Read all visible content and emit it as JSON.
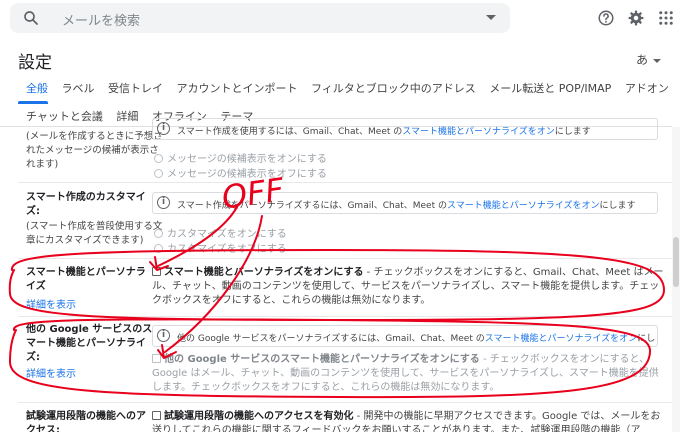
{
  "search": {
    "placeholder": "メールを検索"
  },
  "header": {
    "title": "設定",
    "lang": "あ"
  },
  "tabs_row1": [
    "全般",
    "ラベル",
    "受信トレイ",
    "アカウントとインポート",
    "フィルタとブロック中のアドレス",
    "メール転送と POP/IMAP",
    "アドオン"
  ],
  "tabs_row2": [
    "チャットと会議",
    "詳細",
    "オフライン",
    "テーマ"
  ],
  "row0": {
    "sub": [
      "(メールを作成するときに予想さ",
      "れたメッセージの候補が表示さ",
      "れます)"
    ],
    "info_pre": "スマート作成を使用するには、Gmail、Chat、Meet の",
    "info_link": "スマート機能とパーソナライズをオン",
    "info_post": "にします",
    "radio_on": "メッセージの候補表示をオンにする",
    "radio_off": "メッセージの候補表示をオフにする"
  },
  "row1": {
    "label": [
      "スマート作成のカスタマイ",
      "ズ:"
    ],
    "sub": [
      "(スマート作成を普段使用する文",
      "章にカスタマイズできます)"
    ],
    "info_pre": "スマート作成をパーソナライズするには、Gmail、Chat、Meet の",
    "info_link": "スマート機能とパーソナライズをオン",
    "info_post": "にします",
    "radio_on": "カスタマイズをオンにする",
    "radio_off": "カスタマイズをオフにする"
  },
  "row2": {
    "label": [
      "スマート機能とパーソナラ",
      "イズ"
    ],
    "more": "詳細を表示",
    "bold": "スマート機能とパーソナライズをオンにする",
    "desc": " - チェックボックスをオンにすると、Gmail、Chat、Meet はメール、チャット、動画のコンテンツを使用して、サービスをパーソナライズし、スマート機能を提供します。チェックボックスをオフにすると、これらの機能は無効になります。"
  },
  "row3": {
    "label": [
      "他の Google サービスのス",
      "マート機能とパーソナライ",
      "ズ:"
    ],
    "more": "詳細を表示",
    "info_pre": "他の Google サービスをパーソナライズするには、Gmail、Chat、Meet の",
    "info_link": "スマート機能とパーソナライズをオン",
    "info_post": "にします",
    "bold": "他の Google サービスのスマート機能とパーソナライズをオンにする",
    "desc": " - チェックボックスをオンにすると、Google はメール、チャット、動画のコンテンツを使用して、サービスをパーソナライズし、スマート機能を提供します。チェックボックスをオフにすると、これらの機能は無効になります。"
  },
  "row4": {
    "label": [
      "試験運用段階の機能へのア",
      "クセス:"
    ],
    "bold": "試験運用段階の機能へのアクセスを有効化",
    "desc": " - 開発中の機能に早期アクセスできます。Google では、メールをお送りしてこれらの機能に関するフィードバックをお願いすることがあります。また、試験運用段階の機能（ア"
  },
  "annotation": {
    "text": "OFF",
    "color": "#e8001c"
  }
}
